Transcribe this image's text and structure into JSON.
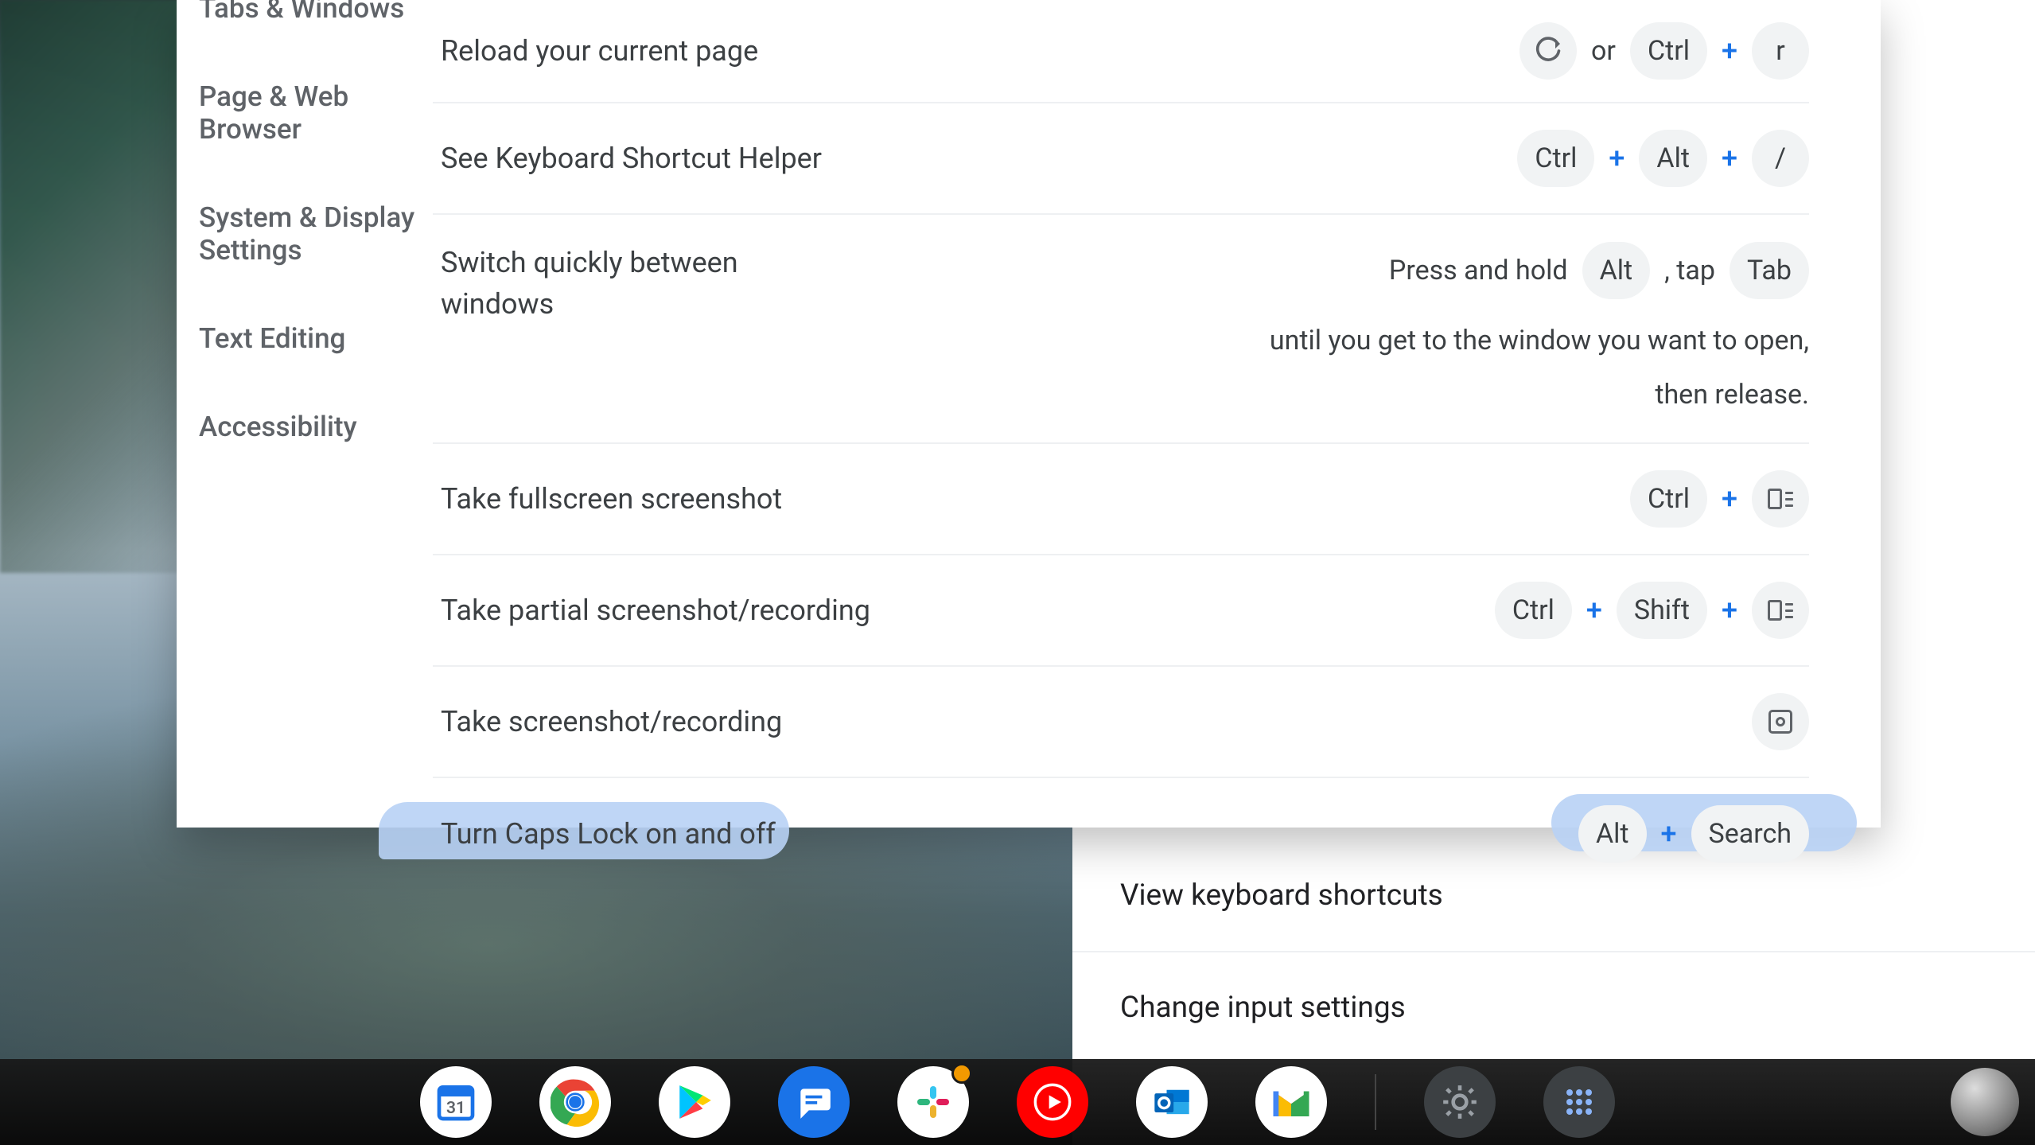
{
  "sidebar": {
    "items": [
      {
        "label": "Tabs & Windows"
      },
      {
        "label": "Page & Web Browser"
      },
      {
        "label": "System & Display Settings"
      },
      {
        "label": "Text Editing"
      },
      {
        "label": "Accessibility"
      }
    ]
  },
  "shortcuts": {
    "reload": {
      "label": "Reload your current page",
      "or": "or",
      "k1": "Ctrl",
      "k2": "r"
    },
    "helper": {
      "label": "See Keyboard Shortcut Helper",
      "k1": "Ctrl",
      "k2": "Alt",
      "k3": "/"
    },
    "switch": {
      "label": "Switch quickly between windows",
      "pre": "Press and hold",
      "k1": "Alt",
      "mid": ", tap",
      "k2": "Tab",
      "post": "until you get to the window you want to open, then release."
    },
    "full_ss": {
      "label": "Take fullscreen screenshot",
      "k1": "Ctrl"
    },
    "partial_ss": {
      "label": "Take partial screenshot/recording",
      "k1": "Ctrl",
      "k2": "Shift"
    },
    "take_ss": {
      "label": "Take screenshot/recording"
    },
    "caps": {
      "label": "Turn Caps Lock on and off",
      "k1": "Alt",
      "k2": "Search"
    }
  },
  "secondary": {
    "view_shortcuts": "View keyboard shortcuts",
    "change_input": "Change input settings"
  },
  "shelf": {
    "apps": [
      {
        "name": "calendar",
        "bg": "#ffffff",
        "accent": "#1a73e8"
      },
      {
        "name": "chrome",
        "bg": "#ffffff"
      },
      {
        "name": "play-store",
        "bg": "#ffffff"
      },
      {
        "name": "messages",
        "bg": "#1a73e8"
      },
      {
        "name": "slack",
        "bg": "#ffffff",
        "badge": true
      },
      {
        "name": "youtube-music",
        "bg": "#ff0000"
      },
      {
        "name": "outlook",
        "bg": "#ffffff",
        "accent": "#0078d4"
      },
      {
        "name": "gmail",
        "bg": "#ffffff"
      }
    ],
    "tray": [
      {
        "name": "settings"
      },
      {
        "name": "input-method"
      }
    ]
  }
}
